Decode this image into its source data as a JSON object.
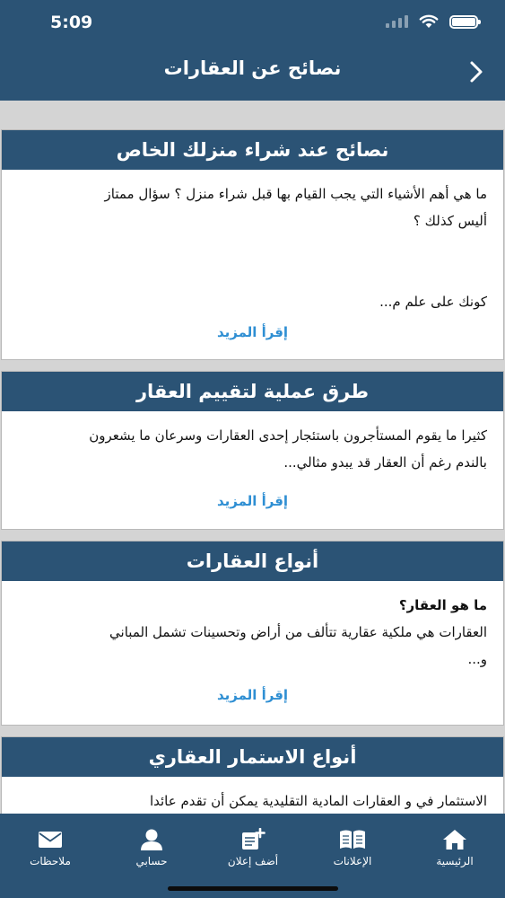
{
  "status_bar": {
    "time": "5:09"
  },
  "header": {
    "title": "نصائح عن العقارات",
    "back_icon": "chevron-right-icon"
  },
  "articles": [
    {
      "title": "نصائح عند شراء منزلك الخاص",
      "lines": [
        "ما هي أهم الأشياء التي يجب القيام بها قبل شراء منزل ؟ سؤال ممتاز",
        "أليس كذلك ؟",
        "",
        "كونك على علم م..."
      ],
      "more": "إقرأ المزيد"
    },
    {
      "title": "طرق عملية لتقييم العقار",
      "lines": [
        "كثيرا ما يقوم المستأجرون باستئجار إحدى العقارات وسرعان ما يشعرون",
        "بالندم رغم أن العقار قد يبدو مثالي..."
      ],
      "more": "إقرأ المزيد"
    },
    {
      "title": "أنواع العقارات",
      "question": "ما هو العقار؟",
      "lines": [
        "العقارات هي ملكية عقارية تتألف من أراض وتحسينات تشمل المباني",
        "و..."
      ],
      "more": "إقرأ المزيد"
    },
    {
      "title": "أنواع الاستمار العقاري",
      "lines": [
        "الاستثمار في و العقارات المادية التقليدية  يمكن أن تقدم عائدا"
      ]
    }
  ],
  "tabbar": {
    "items": [
      {
        "label": "الرئيسية",
        "icon": "home-icon"
      },
      {
        "label": "الإعلانات",
        "icon": "book-icon"
      },
      {
        "label": "أضف إعلان",
        "icon": "add-post-icon"
      },
      {
        "label": "حسابي",
        "icon": "user-icon"
      },
      {
        "label": "ملاحظات",
        "icon": "mail-icon"
      }
    ]
  },
  "colors": {
    "primary": "#2b5375",
    "link": "#2f8fd3",
    "background": "#d4d4d4"
  }
}
